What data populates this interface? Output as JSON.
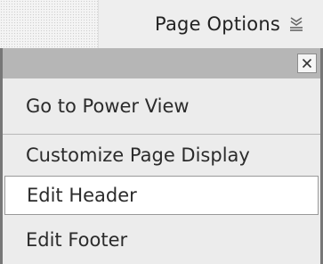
{
  "toolbar": {
    "options_label": "Page Options",
    "options_icon": "chevron-double-down-icon"
  },
  "menu": {
    "close_icon": "close-icon",
    "items": [
      {
        "label": "Go to Power View"
      },
      {
        "label": "Customize Page Display"
      },
      {
        "label": "Edit Header",
        "highlighted": true
      },
      {
        "label": "Edit Footer"
      }
    ]
  },
  "colors": {
    "menu_background": "#ececec",
    "menu_header": "#b6b6b6",
    "menu_border": "#777777",
    "highlight_background": "#ffffff"
  }
}
